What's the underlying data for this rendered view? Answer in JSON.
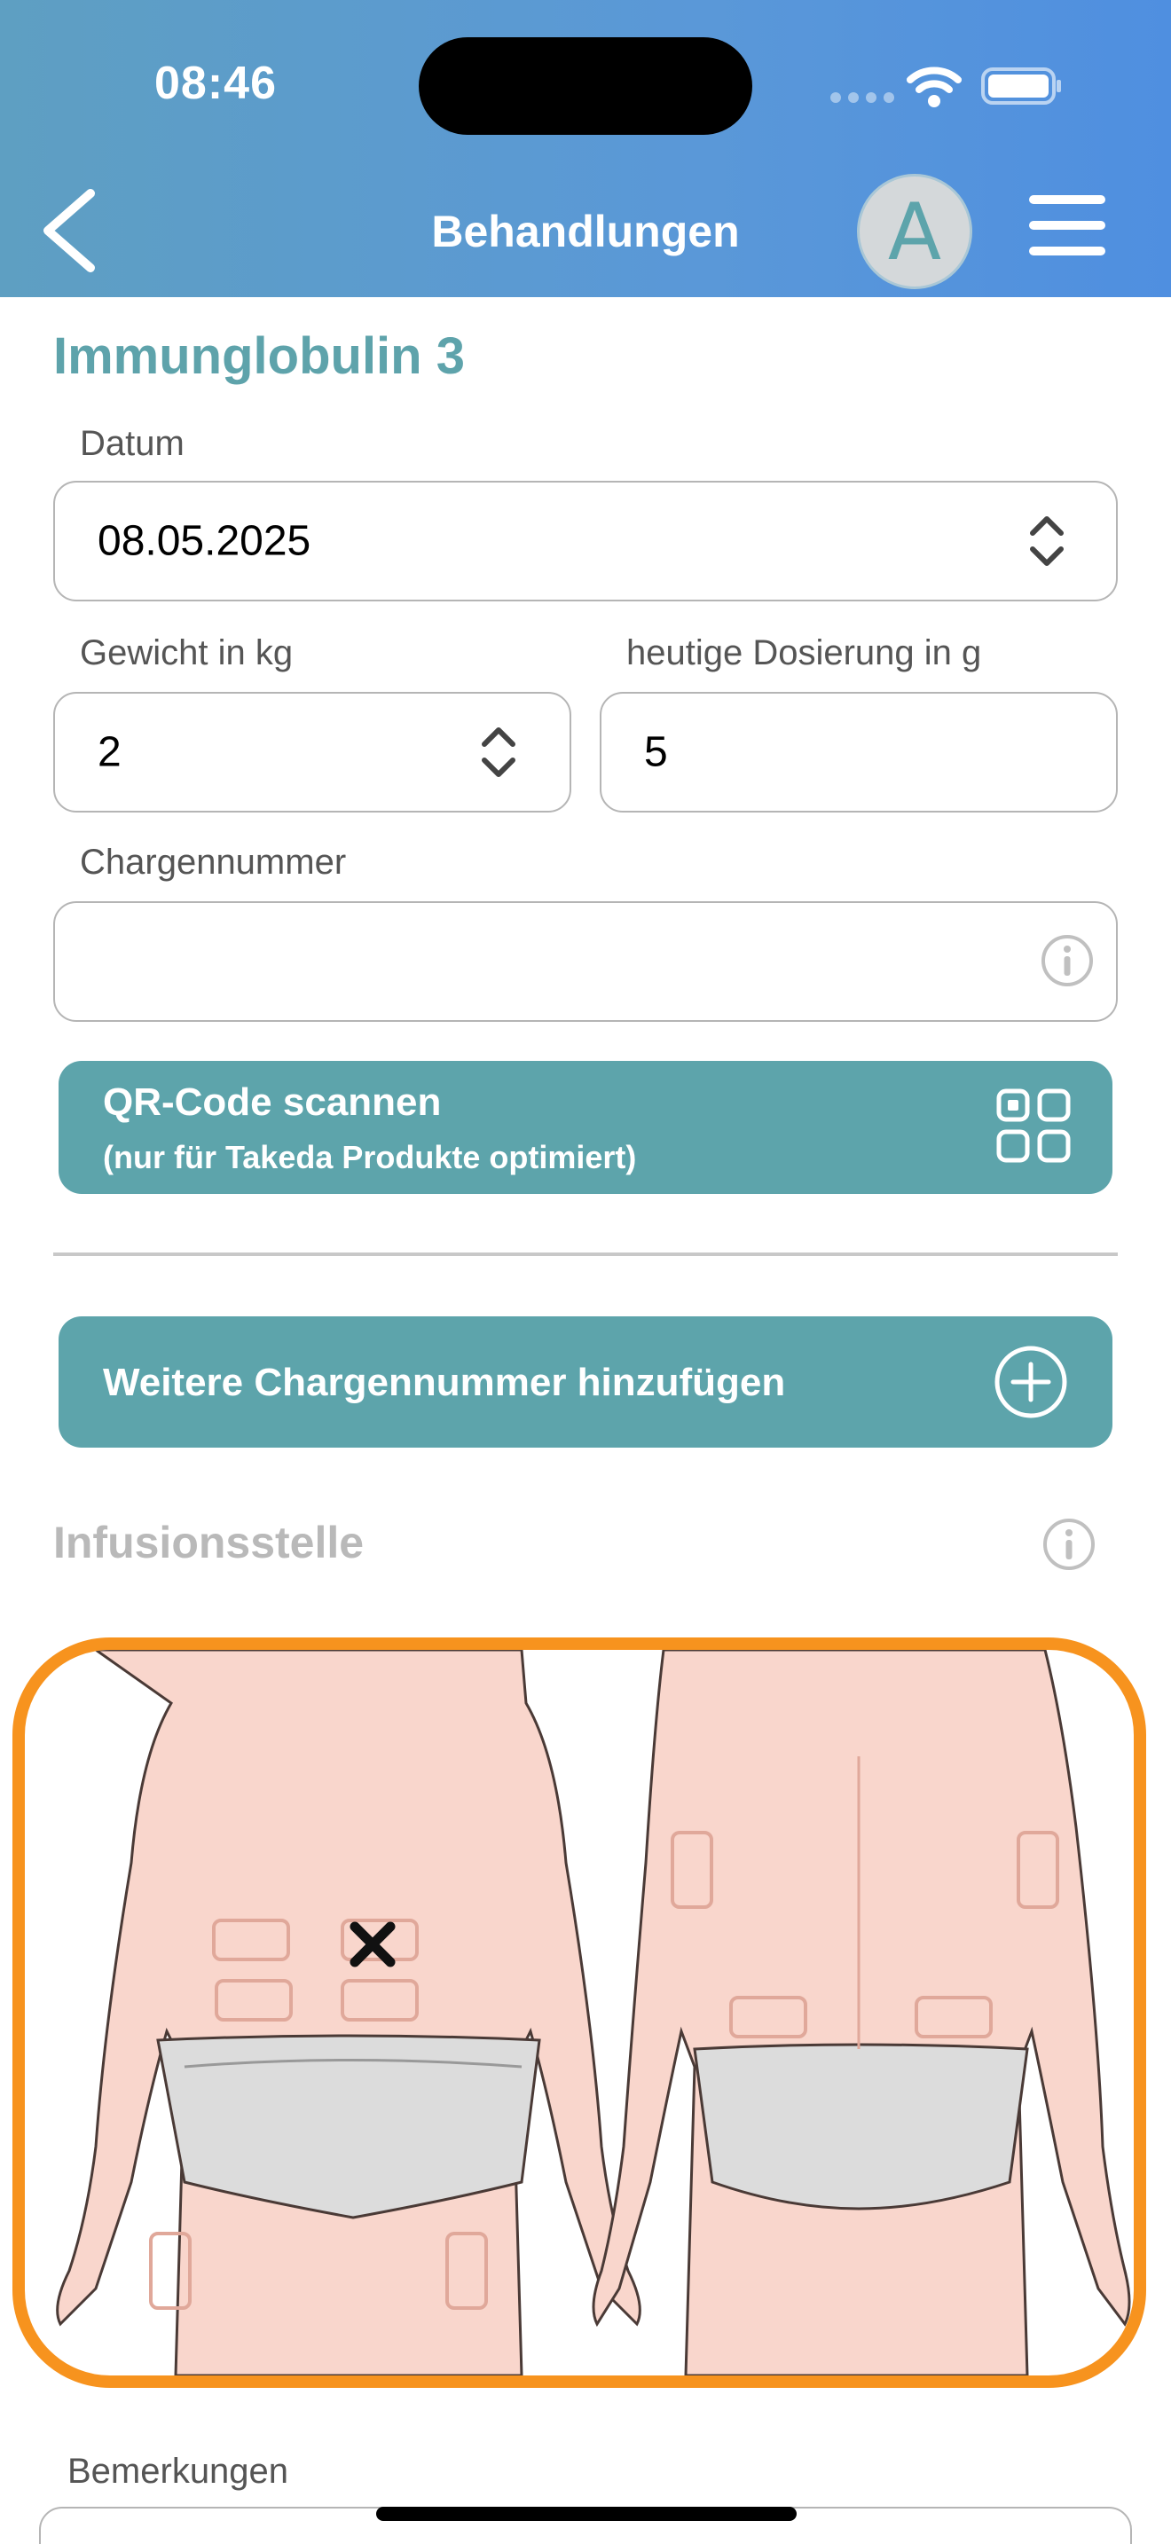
{
  "status_bar": {
    "time": "08:46"
  },
  "header": {
    "title": "Behandlungen",
    "avatar_letter": "A"
  },
  "form": {
    "section_title": "Immunglobulin 3",
    "date": {
      "label": "Datum",
      "value": "08.05.2025"
    },
    "weight": {
      "label": "Gewicht in kg",
      "value": "2"
    },
    "dose": {
      "label": "heutige Dosierung in g",
      "value": "5"
    },
    "batch": {
      "label": "Chargennummer",
      "value": ""
    },
    "qr_button": {
      "label": "QR-Code scannen",
      "sublabel": "(nur für Takeda Produkte optimiert)"
    },
    "add_batch_button": {
      "label": "Weitere Chargennummer hinzufügen"
    },
    "infusion_site": {
      "label": "Infusionsstelle"
    },
    "remarks": {
      "label": "Bemerkungen"
    }
  },
  "colors": {
    "accent": "#5da4ab",
    "highlight_border": "#f7931e",
    "header_start": "#5e9fc2",
    "header_end": "#4f8fe0"
  }
}
